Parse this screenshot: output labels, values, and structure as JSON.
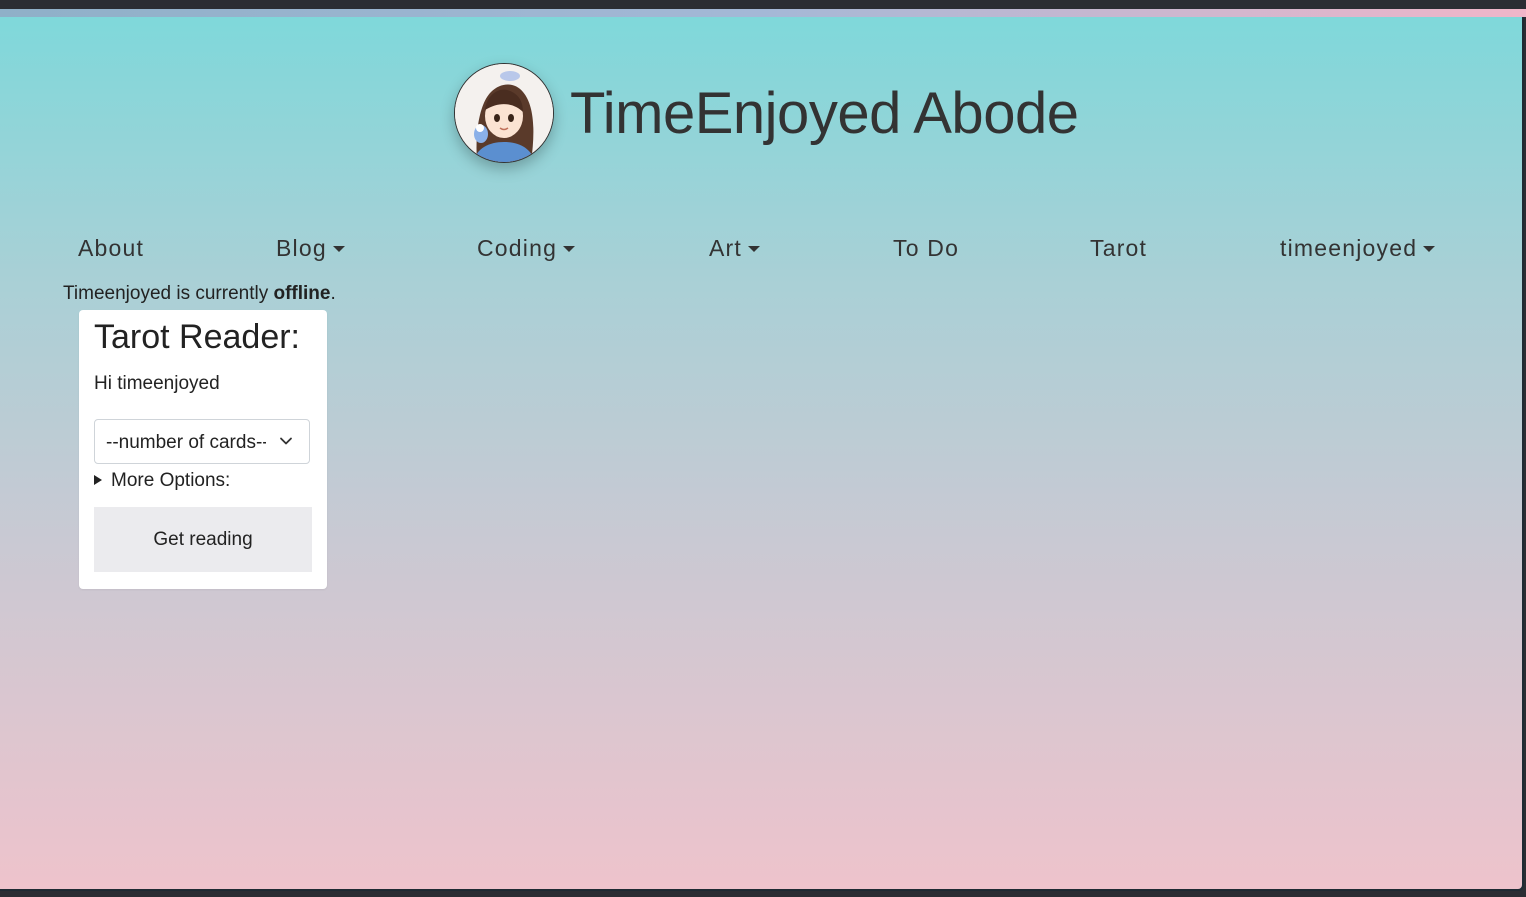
{
  "site": {
    "title": "TimeEnjoyed Abode"
  },
  "nav": {
    "items": [
      {
        "label": "About",
        "dropdown": false
      },
      {
        "label": "Blog",
        "dropdown": true
      },
      {
        "label": "Coding",
        "dropdown": true
      },
      {
        "label": "Art",
        "dropdown": true
      },
      {
        "label": "To Do",
        "dropdown": false
      },
      {
        "label": "Tarot",
        "dropdown": false
      },
      {
        "label": "timeenjoyed",
        "dropdown": true
      }
    ]
  },
  "status": {
    "prefix": "Timeenjoyed is currently ",
    "state": "offline",
    "suffix": "."
  },
  "tarot": {
    "title": "Tarot Reader:",
    "greeting": "Hi timeenjoyed",
    "select_value": "--number of cards--",
    "more_options": "More Options:",
    "button": "Get reading"
  },
  "colors": {
    "gradient_top": "#7fd8da",
    "gradient_bottom": "#eec3cc",
    "text": "#333333",
    "button_bg": "#ebebee"
  }
}
